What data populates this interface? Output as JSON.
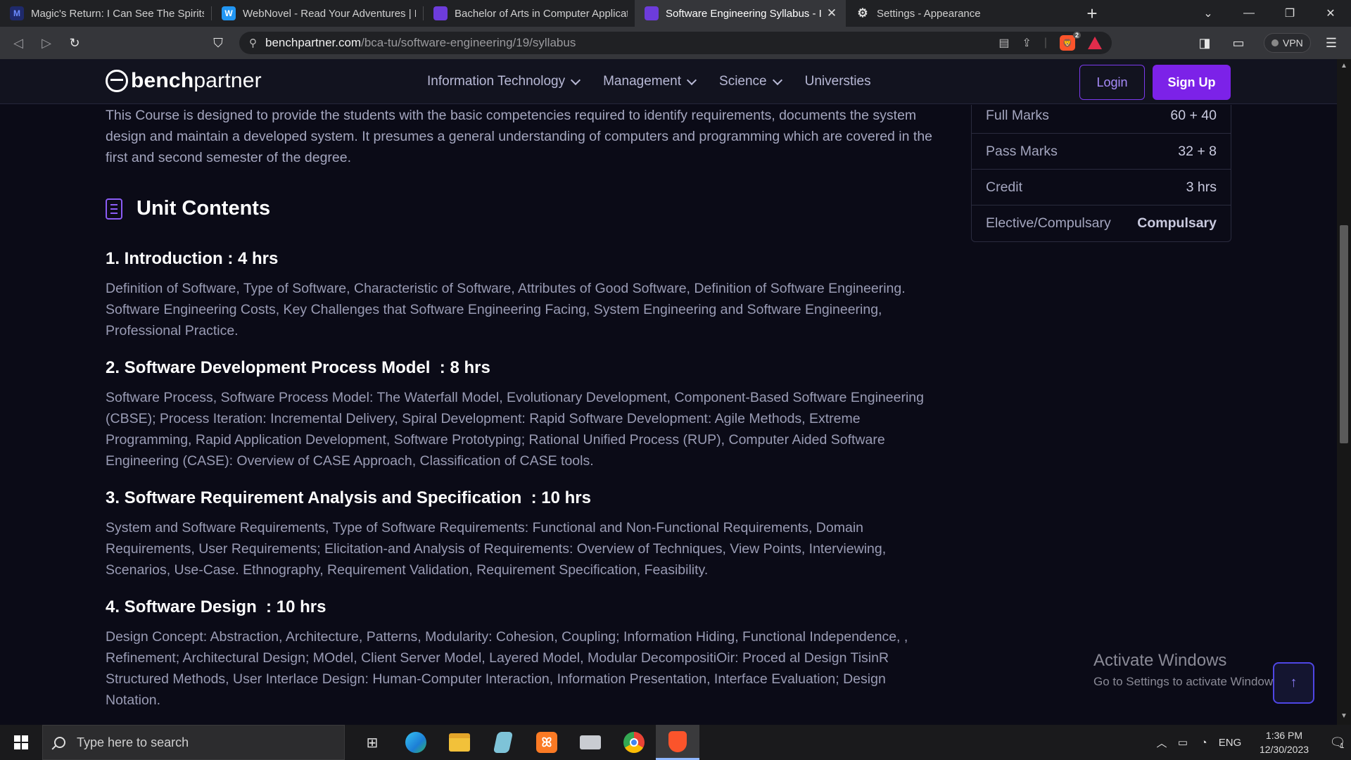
{
  "browser": {
    "tabs": [
      {
        "title": "Magic's Return: I Can See The Spirits -",
        "fav_color": "#3b5bdb",
        "fav_text": "M"
      },
      {
        "title": "WebNovel - Read Your Adventures | Fi",
        "fav_color": "#2196f3",
        "fav_text": "W"
      },
      {
        "title": "Bachelor of Arts in Computer Applicat",
        "fav_color": "#7c3aed",
        "fav_text": ""
      },
      {
        "title": "Software Engineering Syllabus - I",
        "fav_color": "#7c3aed",
        "fav_text": ""
      },
      {
        "title": "Settings - Appearance",
        "fav_color": "#444444",
        "fav_text": "⚙"
      }
    ],
    "url_host": "benchpartner.com",
    "url_path": "/bca-tu/software-engineering/19/syllabus",
    "shields_count": "2",
    "vpn_label": "VPN"
  },
  "site": {
    "logo_bold": "bench",
    "logo_rest": "partner",
    "nav": [
      "Information Technology",
      "Management",
      "Science",
      "Universties"
    ],
    "login": "Login",
    "signup": "Sign Up"
  },
  "page": {
    "intro": "This Course is designed to provide the students with the basic competencies required to identify requirements, documents the system design and maintain a developed system. It presumes a general understanding of computers and programming which are covered in the first and second semester of the degree.",
    "section_title": "Unit Contents",
    "units": [
      {
        "title": "1. Introduction : 4 hrs",
        "body": "Definition of Software, Type of Software, Characteristic of Software, Attributes of Good Software, Definition of Software Engineering. Software Engineering Costs, Key Challenges that Software Engineering Facing, System Engineering and Software Engineering, Professional Practice."
      },
      {
        "title": "2. Software Development Process Model  : 8 hrs",
        "body": "Software Process, Software Process Model: The Waterfall Model, Evolutionary Development, Component-Based Software Engineering (CBSE); Process Iteration: Incremental Delivery, Spiral Development: Rapid Software Development: Agile Methods, Extreme Programming, Rapid Application Development, Software Prototyping; Rational Unified Process (RUP), Computer Aided Software Engineering (CASE): Overview of CASE Approach, Classification of CASE tools."
      },
      {
        "title": "3. Software Requirement Analysis and Specification  : 10 hrs",
        "body": "System and Software Requirements, Type of Software Requirements: Functional and Non-Functional Requirements, Domain Requirements, User Requirements; Elicitation-and Analysis of Requirements: Overview of Techniques, View Points, Interviewing, Scenarios, Use-Case. Ethnography, Requirement Validation, Requirement Specification, Feasibility."
      },
      {
        "title": "4. Software Design  : 10 hrs",
        "body": "Design Concept: Abstraction, Architecture, Patterns, Modularity: Cohesion, Coupling; Information Hiding, Functional Independence, , Refinement; Architectural Design; MOdel, Client Server Model, Layered Model, Modular DecompositiOir: Proced al Design TisinR Structured Methods, User Interlace Design: Human-Computer Interaction, Information Presentation, Interface Evaluation; Design Notation."
      }
    ],
    "info": [
      {
        "key": "Full Marks",
        "value": "60 + 40"
      },
      {
        "key": "Pass Marks",
        "value": "32 + 8"
      },
      {
        "key": "Credit",
        "value": "3 hrs"
      },
      {
        "key": "Elective/Compulsary",
        "value": "Compulsary"
      }
    ]
  },
  "watermark": {
    "line1": "Activate Windows",
    "line2": "Go to Settings to activate Windows."
  },
  "taskbar": {
    "search_placeholder": "Type here to search",
    "language": "ENG",
    "time": "1:36 PM",
    "date": "12/30/2023",
    "notif_count": "1"
  }
}
